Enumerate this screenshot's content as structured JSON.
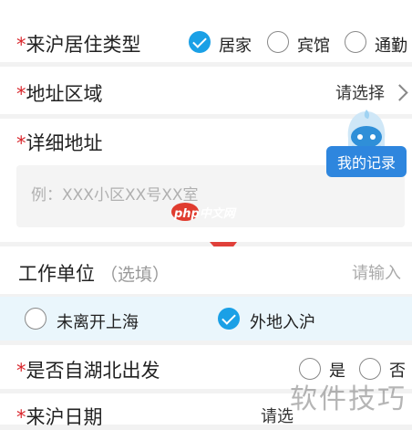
{
  "residence": {
    "label": "来沪居住类型",
    "options": [
      {
        "label": "居家",
        "checked": true
      },
      {
        "label": "宾馆",
        "checked": false
      },
      {
        "label": "通勤",
        "checked": false
      }
    ]
  },
  "region": {
    "label": "地址区域",
    "value": "请选择"
  },
  "detail": {
    "label": "详细地址",
    "placeholder": "例：XXX小区XX号XX室"
  },
  "records_button": {
    "label": "我的记录"
  },
  "watermark_logo": {
    "text": "php中文网"
  },
  "work": {
    "label": "工作单位",
    "optional": "（选填）",
    "placeholder": "请输入"
  },
  "origin": {
    "options": [
      {
        "label": "未离开上海",
        "checked": false
      },
      {
        "label": "外地入沪",
        "checked": true
      }
    ]
  },
  "hubei": {
    "label": "是否自湖北出发",
    "options": [
      "是",
      "否"
    ]
  },
  "date": {
    "label": "来沪日期",
    "value": "请选"
  },
  "watermark_corner": {
    "text": "软件技巧"
  },
  "colors": {
    "accent": "#1aa0e6",
    "required": "#d9262c",
    "arrow": "#e0403a"
  }
}
